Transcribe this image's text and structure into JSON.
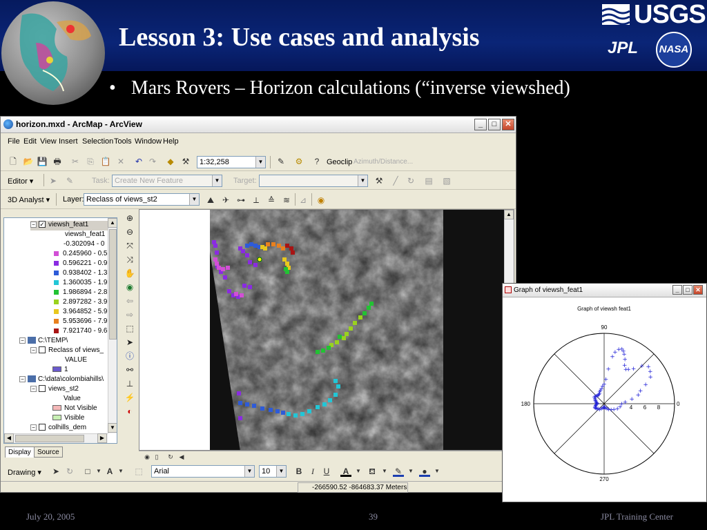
{
  "slide": {
    "title": "Lesson 3: Use cases and analysis",
    "bullet_marker": "•",
    "bullet": "Mars Rovers – Horizon calculations (“inverse viewshed)",
    "logos": {
      "usgs": "USGS",
      "jpl": "JPL",
      "nasa": "NASA"
    },
    "footer": {
      "date": "July 20, 2005",
      "page": "39",
      "org": "JPL Training Center"
    },
    "colors": {
      "header_bg": "#0a2577",
      "body_bg": "#000000",
      "text": "#ffffff",
      "footer_text": "#8a8aa0"
    }
  },
  "arcmap": {
    "title": "horizon.mxd - ArcMap - ArcView",
    "window_buttons": {
      "minimize": "_",
      "maximize": "□",
      "close": "✕"
    },
    "menu": [
      "File",
      "Edit",
      "View",
      "Insert",
      "Selection",
      "Tools",
      "Window",
      "Help"
    ],
    "standard_toolbar": {
      "scale": "1:32,258",
      "geoclip_label": "Geoclip",
      "azimuth_label": "Azimuth/Distance..."
    },
    "editor_toolbar": {
      "editor_label": "Editor ▾",
      "task_label": "Task:",
      "task_value": "Create New Feature",
      "target_label": "Target:",
      "target_value": ""
    },
    "analyst_toolbar": {
      "analyst_label": "3D Analyst ▾",
      "layer_label": "Layer:",
      "layer_value": "Reclass of views_st2"
    },
    "toc": {
      "layer1": {
        "name": "viewsh_feat1",
        "checked": true,
        "field": "viewsh_feat1"
      },
      "classes": [
        {
          "label": "-0.302094 - 0",
          "color": ""
        },
        {
          "label": "0.245960 - 0.5",
          "color": "#d24fd6"
        },
        {
          "label": "0.596221 - 0.9",
          "color": "#8a2be2"
        },
        {
          "label": "0.938402 - 1.3",
          "color": "#2e5bd8"
        },
        {
          "label": "1.360035 - 1.9",
          "color": "#22c6d6"
        },
        {
          "label": "1.986894 - 2.8",
          "color": "#22c233"
        },
        {
          "label": "2.897282 - 3.9",
          "color": "#9ad21e"
        },
        {
          "label": "3.964852 - 5.9",
          "color": "#e8c81e"
        },
        {
          "label": "5.953696 - 7.9",
          "color": "#e8801e"
        },
        {
          "label": "7.921740 - 9.6",
          "color": "#a81414"
        }
      ],
      "frame1": "C:\\TEMP\\",
      "layer2": {
        "name": "Reclass of views_",
        "field": "VALUE",
        "value": "1",
        "color": "#6a5acd"
      },
      "frame2": "C:\\data\\colombiahills\\",
      "layer3": {
        "name": "views_st2",
        "field": "Value",
        "items": [
          {
            "label": "Not Visible",
            "color": "#f4b8b8"
          },
          {
            "label": "Visible",
            "color": "#c8f0b4"
          }
        ]
      },
      "layer4": {
        "name": "colhills_dem"
      },
      "tabs": [
        "Display",
        "Source"
      ]
    },
    "drawing_toolbar": {
      "drawing_label": "Drawing ▾",
      "font": "Arial",
      "size": "10",
      "bold": "B",
      "italic": "I",
      "underline": "U"
    },
    "status": {
      "coordinates": "-266590.52  -864683.37 Meters"
    }
  },
  "graph": {
    "window_title": "Graph of viewsh_feat1",
    "window_buttons": {
      "minimize": "_",
      "maximize": "□",
      "close": "✕"
    },
    "chart_title": "Graph of viewsh feat1",
    "angle_labels": {
      "top": "90",
      "left": "180",
      "right": "0",
      "bottom": "270"
    },
    "radial_ticks": [
      "4",
      "6",
      "8"
    ]
  },
  "chart_data": {
    "type": "scatter",
    "title": "Graph of viewsh feat1",
    "coordinate_system": "polar",
    "angle_ticks": [
      0,
      90,
      180,
      270
    ],
    "radial_ticks": [
      4,
      6,
      8
    ],
    "rlim": [
      0,
      10
    ],
    "marker": "+",
    "color": "#1f1fd6",
    "series": [
      {
        "theta": [
          0,
          5,
          10,
          15,
          20,
          25,
          30,
          35,
          40,
          45,
          50,
          55,
          58,
          62,
          65,
          68,
          70,
          72,
          75,
          78,
          80,
          83,
          86,
          90,
          95,
          100,
          105,
          110,
          115,
          120,
          125,
          130,
          135,
          140,
          145,
          150,
          155,
          160,
          165,
          170,
          175,
          180,
          185,
          190,
          195,
          200,
          205,
          210,
          215,
          220,
          230,
          240,
          250,
          260,
          270,
          280,
          290,
          300,
          310,
          320,
          330,
          340,
          350
        ],
        "r": [
          2.5,
          3,
          4,
          5,
          5.5,
          6.5,
          7.6,
          8,
          8.2,
          7.6,
          6.5,
          6,
          5.8,
          6.2,
          7,
          7.6,
          8,
          8.2,
          8,
          7.5,
          6.8,
          5,
          3.5,
          2.8,
          2.5,
          2.2,
          2,
          1.8,
          1.6,
          1.5,
          1.5,
          1.5,
          1.6,
          1.6,
          1.7,
          1.5,
          1.4,
          1.3,
          1.2,
          1.1,
          1,
          1,
          1.1,
          1.2,
          1.3,
          1.4,
          1.4,
          1.3,
          1.2,
          1.1,
          1,
          0.8,
          0.6,
          0.5,
          0.5,
          0.5,
          0.6,
          0.8,
          1,
          1.3,
          1.6,
          2,
          2.3
        ]
      }
    ]
  }
}
